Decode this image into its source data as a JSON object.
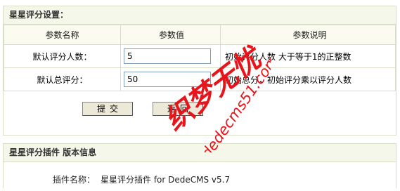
{
  "settings_panel": {
    "title": "星星评分设置："
  },
  "table": {
    "headers": [
      "参数名称",
      "参数值",
      "参数说明"
    ],
    "rows": [
      {
        "name": "默认评分人数：",
        "value": "5",
        "desc": "初始评分人数 大于等于1的正整数"
      },
      {
        "name": "默认总评分：",
        "value": "50",
        "desc": "初始总分，初始评分乘以评分人数"
      }
    ]
  },
  "actions": {
    "submit_label": "提交",
    "back_label": "返回"
  },
  "version_panel": {
    "title": "星星评分插件 版本信息",
    "plugin_name_label": "插件名称：",
    "plugin_name_value": "星星评分插件 for DedeCMS v5.7"
  },
  "watermark": {
    "chinese": "织梦无忧",
    "domain": "dedecms51.com",
    "color": "#e8141c"
  }
}
